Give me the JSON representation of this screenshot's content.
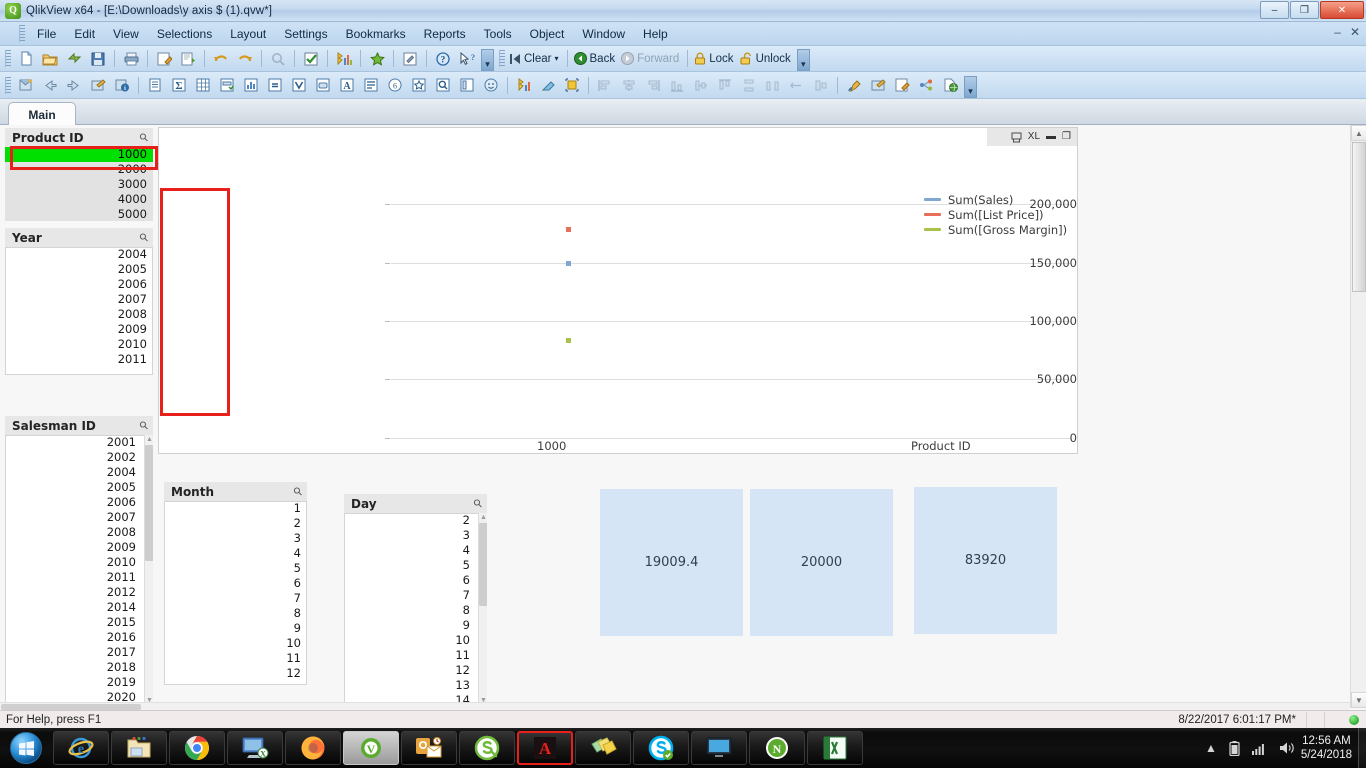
{
  "window": {
    "app_icon": "qlikview-logo-icon",
    "title": "QlikView x64 - [E:\\Downloads\\y axis $ (1).qvw*]",
    "minimize": "–",
    "restore": "❐",
    "close": "✕",
    "inner_minimize": "–",
    "inner_close": "✕"
  },
  "menu": {
    "items": [
      {
        "label": "File"
      },
      {
        "label": "Edit"
      },
      {
        "label": "View"
      },
      {
        "label": "Selections"
      },
      {
        "label": "Layout"
      },
      {
        "label": "Settings"
      },
      {
        "label": "Bookmarks"
      },
      {
        "label": "Reports"
      },
      {
        "label": "Tools"
      },
      {
        "label": "Object"
      },
      {
        "label": "Window"
      },
      {
        "label": "Help"
      }
    ]
  },
  "toolbar_standard": {
    "buttons": [
      {
        "name": "new-icon",
        "glyph": "🗋"
      },
      {
        "name": "open-icon",
        "glyph": "📂"
      },
      {
        "name": "reload-icon",
        "glyph": "⚡"
      },
      {
        "name": "save-icon",
        "glyph": "💾"
      },
      {
        "name": "print-icon",
        "glyph": "🖨"
      },
      {
        "name": "edit-script-icon",
        "glyph": "📝"
      },
      {
        "name": "table-viewer-icon",
        "glyph": "📊"
      },
      {
        "name": "undo-icon",
        "glyph": "↶"
      },
      {
        "name": "redo-icon",
        "glyph": "↷"
      },
      {
        "name": "search-icon",
        "glyph": "🔍"
      },
      {
        "name": "current-selections-icon",
        "glyph": "☑"
      },
      {
        "name": "chart-wizard-icon",
        "glyph": "📈"
      },
      {
        "name": "favorites-icon",
        "glyph": "★"
      },
      {
        "name": "design-grid-icon",
        "glyph": "✎"
      },
      {
        "name": "help-icon",
        "glyph": "?"
      },
      {
        "name": "context-help-icon",
        "glyph": "↖?"
      }
    ]
  },
  "toolbar_navigation": {
    "clear_label": "Clear",
    "back_label": "Back",
    "forward_label": "Forward",
    "lock_label": "Lock",
    "unlock_label": "Unlock",
    "clear_icon": "clear-selections-icon",
    "back_icon": "back-arrow-icon",
    "forward_icon": "forward-arrow-icon",
    "lock_icon": "padlock-closed-icon",
    "unlock_icon": "padlock-open-icon"
  },
  "toolbar_design": {
    "buttons": [
      {
        "name": "new-sheet-icon",
        "glyph": "🗔"
      },
      {
        "name": "promote-sheet-left-icon",
        "glyph": "⇦"
      },
      {
        "name": "promote-sheet-right-icon",
        "glyph": "⇨"
      },
      {
        "name": "sheet-properties-icon",
        "glyph": "🗂"
      },
      {
        "name": "document-properties-icon",
        "glyph": "ⓘ"
      },
      {
        "name": "new-listbox-icon",
        "glyph": "▤"
      },
      {
        "name": "new-statistics-box-icon",
        "glyph": "Σ"
      },
      {
        "name": "new-table-box-icon",
        "glyph": "▦"
      },
      {
        "name": "new-multi-box-icon",
        "glyph": "▣"
      },
      {
        "name": "new-chart-icon",
        "glyph": "📊"
      },
      {
        "name": "new-input-box-icon",
        "glyph": "="
      },
      {
        "name": "new-current-selections-box-icon",
        "glyph": "✓"
      },
      {
        "name": "new-button-icon",
        "glyph": "▭"
      },
      {
        "name": "new-text-object-icon",
        "glyph": "A"
      },
      {
        "name": "new-line-arrow-icon",
        "glyph": "≡"
      },
      {
        "name": "new-slider-calendar-icon",
        "glyph": "◉"
      },
      {
        "name": "new-bookmark-object-icon",
        "glyph": "☆"
      },
      {
        "name": "new-search-object-icon",
        "glyph": "🔍"
      },
      {
        "name": "new-container-icon",
        "glyph": "▤"
      },
      {
        "name": "new-custom-object-icon",
        "glyph": "☺"
      },
      {
        "name": "new-system-table-icon",
        "glyph": "📉"
      },
      {
        "name": "clear-format-icon",
        "glyph": "🧹"
      },
      {
        "name": "fit-zoom-icon",
        "glyph": "⛶"
      },
      {
        "name": "align-left-icon",
        "glyph": "⊫"
      },
      {
        "name": "align-center-h-icon",
        "glyph": "⊹"
      },
      {
        "name": "align-right-icon",
        "glyph": "⊪"
      },
      {
        "name": "align-bottom-icon",
        "glyph": "⊥"
      },
      {
        "name": "align-middle-icon",
        "glyph": "⊕"
      },
      {
        "name": "align-top-icon",
        "glyph": "⊤"
      },
      {
        "name": "distribute-vertical-icon",
        "glyph": "⊞"
      },
      {
        "name": "distribute-horizontal-icon",
        "glyph": "⊡"
      },
      {
        "name": "space-evenly-icon",
        "glyph": "⇔"
      },
      {
        "name": "resize-equal-icon",
        "glyph": "⊟"
      },
      {
        "name": "copy-image-icon",
        "glyph": "🖌"
      },
      {
        "name": "sheet-background-icon",
        "glyph": "🗺"
      },
      {
        "name": "edit-module-icon",
        "glyph": "📝"
      },
      {
        "name": "export-structure-icon",
        "glyph": "⋈"
      },
      {
        "name": "publish-icon",
        "glyph": "🌐"
      }
    ]
  },
  "sheet": {
    "active_tab": "Main"
  },
  "listboxes": [
    {
      "id": "product-id",
      "title": "Product ID",
      "values": [
        "1000",
        "2000",
        "3000",
        "4000",
        "5000"
      ],
      "selected": [
        "1000"
      ],
      "has_scrollbar": false
    },
    {
      "id": "year",
      "title": "Year",
      "values": [
        "2004",
        "2005",
        "2006",
        "2007",
        "2008",
        "2009",
        "2010",
        "2011"
      ],
      "selected": [],
      "has_scrollbar": false
    },
    {
      "id": "salesman-id",
      "title": "Salesman ID",
      "values": [
        "2001",
        "2002",
        "2004",
        "2005",
        "2006",
        "2007",
        "2008",
        "2009",
        "2010",
        "2011",
        "2012",
        "2014",
        "2015",
        "2016",
        "2017",
        "2018",
        "2019",
        "2020"
      ],
      "selected": [],
      "has_scrollbar": true
    },
    {
      "id": "month",
      "title": "Month",
      "values": [
        "1",
        "2",
        "3",
        "4",
        "5",
        "6",
        "7",
        "8",
        "9",
        "10",
        "11",
        "12"
      ],
      "selected": [],
      "has_scrollbar": false
    },
    {
      "id": "day",
      "title": "Day",
      "values": [
        "2",
        "3",
        "4",
        "5",
        "6",
        "7",
        "8",
        "9",
        "10",
        "11",
        "12",
        "13",
        "14"
      ],
      "selected": [],
      "has_scrollbar": true
    }
  ],
  "chart_window": {
    "caption_icons": [
      "copy-to-clipboard-icon",
      "minimize-icon",
      "maximize-icon"
    ],
    "excel_label": "XL",
    "minimize_glyph": "▬",
    "maximize_glyph": "❐"
  },
  "chart_data": {
    "type": "scatter",
    "title": "",
    "xlabel": "Product ID",
    "ylabel": "",
    "categories": [
      "1000"
    ],
    "x_tick_labels": [
      "1000"
    ],
    "y_tick_labels": [
      "0",
      "50,000",
      "100,000",
      "150,000",
      "200,000"
    ],
    "y_ticks": [
      0,
      50000,
      100000,
      150000,
      200000
    ],
    "ylim": [
      0,
      215000
    ],
    "grid": true,
    "legend_position": "right",
    "series": [
      {
        "name": "Sum(Sales)",
        "color": "#7fa7d0",
        "values": [
          150000
        ]
      },
      {
        "name": "Sum([List Price])",
        "color": "#e8705a",
        "values": [
          179000
        ]
      },
      {
        "name": "Sum([Gross Margin])",
        "color": "#a8c24a",
        "values": [
          84000
        ]
      }
    ]
  },
  "kpi_boxes": [
    {
      "id": "kpi-1",
      "value": "19009.4"
    },
    {
      "id": "kpi-2",
      "value": "20000"
    },
    {
      "id": "kpi-3",
      "value": "83920"
    }
  ],
  "statusbar": {
    "help_text": "For Help, press F1",
    "timestamp": "8/22/2017 6:01:17 PM*",
    "led": "green-status-led"
  },
  "taskbar": {
    "start_label": "start-orb-icon",
    "items": [
      {
        "name": "internet-explorer-icon",
        "glyph": "e",
        "active": false
      },
      {
        "name": "file-explorer-icon",
        "glyph": "🗀",
        "active": false
      },
      {
        "name": "google-chrome-icon",
        "glyph": "◎",
        "active": false
      },
      {
        "name": "remote-desktop-icon",
        "glyph": "🖥",
        "active": false
      },
      {
        "name": "mozilla-firefox-icon",
        "glyph": "🦊",
        "active": false
      },
      {
        "name": "qlikview-app-icon",
        "glyph": "V",
        "active": true
      },
      {
        "name": "microsoft-outlook-icon",
        "glyph": "O",
        "active": false
      },
      {
        "name": "skype-for-business-icon",
        "glyph": "S",
        "active": false
      },
      {
        "name": "adobe-acrobat-reader-icon",
        "glyph": "A",
        "active": false
      },
      {
        "name": "sticky-notes-icon",
        "glyph": "🗒",
        "active": false
      },
      {
        "name": "skype-icon",
        "glyph": "S",
        "active": false
      },
      {
        "name": "display-monitor-icon",
        "glyph": "🖵",
        "active": false
      },
      {
        "name": "notepadpp-icon",
        "glyph": "N",
        "active": false
      },
      {
        "name": "microsoft-excel-icon",
        "glyph": "X",
        "active": false
      }
    ],
    "tray": {
      "show_hidden": "▲",
      "battery": "battery-icon",
      "network": "network-signal-icon",
      "volume": "speaker-volume-icon",
      "time": "12:56 AM",
      "date": "5/24/2018"
    }
  }
}
